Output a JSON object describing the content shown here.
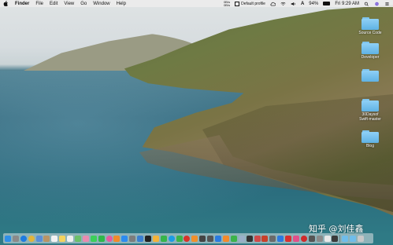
{
  "menubar": {
    "app_menu": [
      "Finder",
      "File",
      "Edit",
      "View",
      "Go",
      "Window",
      "Help"
    ],
    "network_speed": {
      "up": "0B/s",
      "down": "0B/s"
    },
    "default_profile": "Default profile",
    "battery_percent_text": "94%",
    "battery_level": 0.94,
    "clock": "Fri 9:29 AM"
  },
  "desktop": {
    "items": [
      {
        "label": "Source Code"
      },
      {
        "label": "Developer"
      },
      {
        "label": ""
      },
      {
        "label": "30Daysof Swift-master"
      },
      {
        "label": "Blog"
      }
    ],
    "folder_color": "#6fbdea"
  },
  "watermark": "知乎 @刘佳鑫",
  "dock": {
    "apps": [
      {
        "name": "finder-icon",
        "color": "#2f8fe8"
      },
      {
        "name": "launchpad-icon",
        "color": "#8a8a8a"
      },
      {
        "name": "safari-icon",
        "color": "#1e7be0"
      },
      {
        "name": "chrome-icon",
        "color": "#e2b53a"
      },
      {
        "name": "mail-icon",
        "color": "#5a8fd8"
      },
      {
        "name": "contacts-icon",
        "color": "#b89466"
      },
      {
        "name": "calendar-icon",
        "color": "#f2f2f2"
      },
      {
        "name": "notes-icon",
        "color": "#f4d35e"
      },
      {
        "name": "reminders-icon",
        "color": "#efefef"
      },
      {
        "name": "maps-icon",
        "color": "#6cbf6a"
      },
      {
        "name": "photos-icon",
        "color": "#e88bb0"
      },
      {
        "name": "messages-icon",
        "color": "#3ccf5a"
      },
      {
        "name": "facetime-icon",
        "color": "#2fb84a"
      },
      {
        "name": "itunes-icon",
        "color": "#e65aa0"
      },
      {
        "name": "ibooks-icon",
        "color": "#f08a2a"
      },
      {
        "name": "appstore-icon",
        "color": "#2c8cf0"
      },
      {
        "name": "system-preferences-icon",
        "color": "#7d7d7d"
      },
      {
        "name": "xcode-icon",
        "color": "#3a7fd0"
      },
      {
        "name": "terminal-icon",
        "color": "#222222"
      },
      {
        "name": "sketch-icon",
        "color": "#f2b33a"
      },
      {
        "name": "wechat-icon",
        "color": "#37b54a"
      },
      {
        "name": "qq-icon",
        "color": "#1c9be6"
      },
      {
        "name": "evernote-icon",
        "color": "#3db34a"
      },
      {
        "name": "netease-music-icon",
        "color": "#d8332a"
      },
      {
        "name": "sublime-icon",
        "color": "#f0902a"
      },
      {
        "name": "github-icon",
        "color": "#444444"
      },
      {
        "name": "dash-icon",
        "color": "#555555"
      },
      {
        "name": "keynote-icon",
        "color": "#2a7be0"
      },
      {
        "name": "pages-icon",
        "color": "#f28a2a"
      },
      {
        "name": "numbers-icon",
        "color": "#3cb34a"
      },
      {
        "name": "preview-icon",
        "color": "#9ab0c8"
      },
      {
        "name": "activity-monitor-icon",
        "color": "#333333"
      },
      {
        "name": "instruments-icon",
        "color": "#d04a4a"
      },
      {
        "name": "paw-icon",
        "color": "#c8402a"
      },
      {
        "name": "simulator-icon",
        "color": "#6a6a6a"
      },
      {
        "name": "thunder-icon",
        "color": "#2c7ae0"
      },
      {
        "name": "youdao-icon",
        "color": "#d83030"
      },
      {
        "name": "cleanmymac-icon",
        "color": "#e0508a"
      },
      {
        "name": "opera-icon",
        "color": "#d02a2a"
      },
      {
        "name": "keychain-icon",
        "color": "#555555"
      },
      {
        "name": "disk-utility-icon",
        "color": "#8a8a8a"
      },
      {
        "name": "textedit-icon",
        "color": "#e8e8e8"
      },
      {
        "name": "console-icon",
        "color": "#3a3a3a"
      },
      {
        "name": "downloads-folder-icon",
        "color": "#6fbdea"
      },
      {
        "name": "documents-folder-icon",
        "color": "#6fbdea"
      },
      {
        "name": "trash-icon",
        "color": "#c8c8c8"
      }
    ]
  }
}
